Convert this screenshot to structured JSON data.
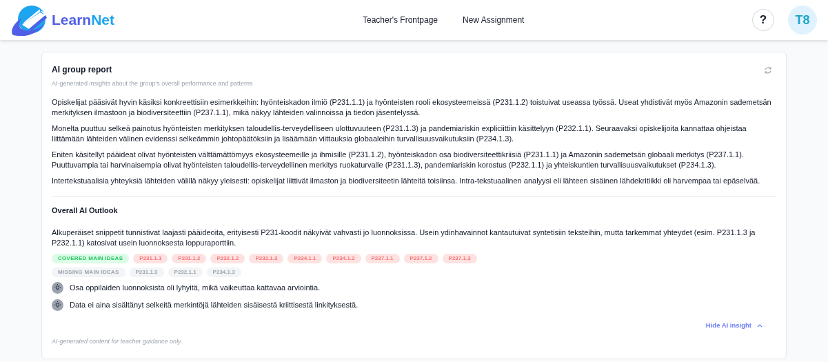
{
  "header": {
    "logo": {
      "part_1": "Learn",
      "part_2": "Net"
    },
    "nav": [
      "Teacher's Frontpage",
      "New Assignment"
    ],
    "help": "?",
    "avatar": "T8"
  },
  "report": {
    "title": "AI group report",
    "subtitle": "AI-generated insights about the group's overall performance and patterns",
    "paragraphs": [
      "Opiskelijat pääsivät hyvin käsiksi konkreettisiin esimerkkeihin: hyönteiskadon ilmiö (P231.1.1) ja hyönteisten rooli ekosysteemeissä (P231.1.2) toistuivat useassa työssä. Useat yhdistivät myös Amazonin sademetsän merkityksen ilmastoon ja biodiversiteettiin (P237.1.1), mikä näkyy lähteiden valinnoissa ja tiedon jäsentelyssä.",
      "Monelta puuttuu selkeä painotus hyönteisten merkityksen taloudellis-terveydelliseen ulottuvuuteen (P231.1.3) ja pandemiariskin expliciittiin käsittelyyn (P232.1.1). Seuraavaksi opiskelijoita kannattaa ohjeistaa liittämään lähteiden välinen evidenssi selkeämmin johtopäätöksiin ja lisäämään viittauksia globaaleihin turvallisuusvaikutuksiin (P234.1.3).",
      "Eniten käsitellyt pääideat olivat hyönteisten välttämättömyys ekosysteemeille ja ihmisille (P231.1.2), hyönteiskadon osa biodiversiteettikriisiä (P231.1.1) ja Amazonin sademetsän globaali merkitys (P237.1.1). Puuttuvampia tai harvinaisempia olivat hyönteisten taloudellis-terveydellinen merkitys ruokaturvalle (P231.1.3), pandemiariskin korostus (P232.1.1) ja yhteiskuntien turvallisuusvaikutukset (P234.1.3).",
      "Intertekstuaalisia yhteyksiä lähteiden välillä näkyy yleisesti: opiskelijat liittivät ilmaston ja biodiversiteetin lähteitä toisiinsa. Intra-tekstuaalinen analyysi eli lähteen sisäinen lähdekritiikki oli harvempaa tai epäselvää."
    ],
    "outlook": {
      "title": "Overall AI Outlook",
      "text": "Alkuperäiset snippetit tunnistivat laajasti pääideoita, erityisesti P231-koodit näkyivät vahvasti jo luonnoksissa. Usein ydinhavainnot kantautuivat syntetisiin teksteihin, mutta tarkemmat yhteydet (esim. P231.1.3 ja P232.1.1) katosivat usein luonnoksesta loppuraporttiin.",
      "tag_groups": [
        {
          "kind": "covered",
          "label": "COVERED MAIN IDEAS",
          "tags": [
            "P231.1.1",
            "P231.1.2",
            "P232.1.2",
            "P232.1.3",
            "P234.1.1",
            "P234.1.2",
            "P237.1.1",
            "P237.1.2",
            "P237.1.3"
          ]
        },
        {
          "kind": "missing",
          "label": "MISSING MAIN IDEAS",
          "tags": [
            "P231.1.3",
            "P232.1.1",
            "P234.1.3"
          ]
        }
      ],
      "notes": [
        "Osa oppilaiden luonnoksista oli lyhyitä, mikä vaikeuttaa kattavaa arviointia.",
        "Data ei aina sisältänyt selkeitä merkintöjä lähteiden sisäisestä kriittisestä linkityksestä."
      ]
    },
    "toggle": "Hide AI insight",
    "footer": "AI-generated content for teacher guidance only."
  }
}
